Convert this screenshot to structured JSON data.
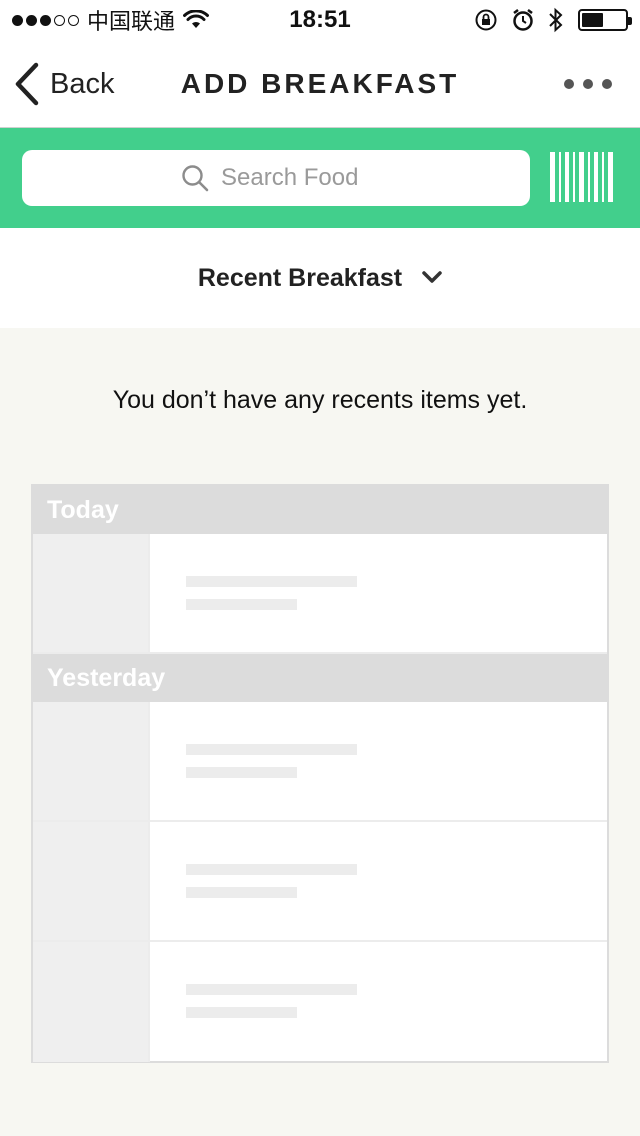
{
  "status_bar": {
    "signal_dots_filled": 3,
    "signal_dots_total": 5,
    "carrier": "中国联通",
    "time": "18:51",
    "battery_level": 0.5
  },
  "nav": {
    "back_label": "Back",
    "title": "ADD BREAKFAST"
  },
  "search": {
    "placeholder": "Search Food",
    "value": ""
  },
  "recent": {
    "label": "Recent Breakfast"
  },
  "empty_message": "You don’t have any recents items yet.",
  "placeholder_sections": [
    {
      "label": "Today",
      "rows": 1
    },
    {
      "label": "Yesterday",
      "rows": 3
    }
  ],
  "colors": {
    "accent_green": "#42cf8c",
    "background": "#f7f7f2",
    "placeholder_gray": "#dcdcdc"
  },
  "icons": {
    "back": "chevron-left-icon",
    "more": "ellipsis-icon",
    "search": "magnifier-icon",
    "barcode": "barcode-icon",
    "dropdown": "chevron-down-icon"
  }
}
